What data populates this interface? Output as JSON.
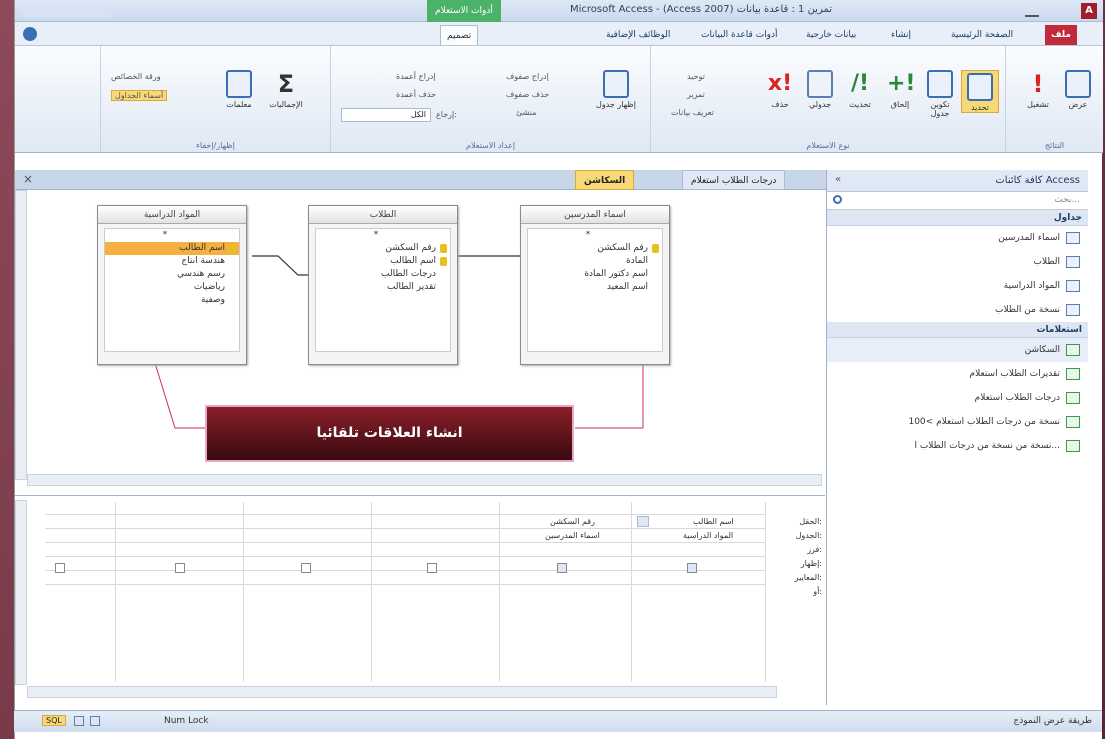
{
  "title_bar": {
    "app_title": "Microsoft Access - (Access 2007) تمرين 1 : قاعدة بيانات",
    "context_title": "أدوات الاستعلام",
    "app_badge": "A"
  },
  "tabs": [
    {
      "label": "ملف"
    },
    {
      "label": "الصفحة الرئيسية"
    },
    {
      "label": "إنشاء"
    },
    {
      "label": "بيانات خارجية"
    },
    {
      "label": "أدوات قاعدة البيانات"
    },
    {
      "label": "الوظائف الإضافية"
    },
    {
      "label": "تصميم"
    }
  ],
  "ribbon": {
    "results": {
      "label": "النتائج",
      "buttons": [
        {
          "label": "عرض"
        },
        {
          "label": "تشغيل"
        }
      ]
    },
    "query_type": {
      "label": "نوع الاستعلام",
      "buttons": [
        {
          "label": "تحديد"
        },
        {
          "label": "تكوين جدول"
        },
        {
          "label": "إلحاق"
        },
        {
          "label": "تحديث"
        },
        {
          "label": "جدولي"
        },
        {
          "label": "حذف"
        }
      ],
      "small": [
        {
          "label": "توحيد"
        },
        {
          "label": "تمرير"
        },
        {
          "label": "تعريف بيانات"
        }
      ]
    },
    "setup": {
      "label": "إعداد الاستعلام",
      "show_table": "إظهار جدول",
      "small": [
        {
          "label": "إدراج صفوف"
        },
        {
          "label": "حذف صفوف"
        },
        {
          "label": "منشئ"
        },
        {
          "label": "إدراج أعمدة"
        },
        {
          "label": "حذف أعمدة"
        },
        {
          "label": "إرجاع:"
        }
      ],
      "return_value": "الكل"
    },
    "showhide": {
      "label": "إظهار/إخفاء",
      "totals": "الإجماليات",
      "params": "معلمات",
      "property_sheet": "ورقة الخصائص",
      "table_names": "أسماء الجداول"
    }
  },
  "document_tabs": [
    {
      "label": "درجات الطلاب استعلام"
    },
    {
      "label": "السكاشن"
    }
  ],
  "tables": [
    {
      "title": "اسماء المدرسين",
      "fields": [
        "*",
        "رقم السكشن",
        "المادة",
        "اسم دكتور المادة",
        "اسم المعيد"
      ]
    },
    {
      "title": "الطلاب",
      "fields": [
        "*",
        "رقم السكشن",
        "اسم الطالب",
        "درجات الطالب",
        "تقدير الطالب"
      ]
    },
    {
      "title": "المواد الدراسية",
      "fields": [
        "*",
        "اسم الطالب",
        "هندسة انتاج",
        "رسم هندسي",
        "رياضيات",
        "وصفية"
      ]
    }
  ],
  "callout": {
    "text": "انشاء العلاقات تلقائيا"
  },
  "qbe": {
    "row_labels": [
      "الحقل:",
      "الجدول:",
      "فرز:",
      "إظهار:",
      "المعايير:",
      "أو:"
    ],
    "columns": [
      {
        "field": "اسم الطالب",
        "table": "المواد الدراسية"
      },
      {
        "field": "رقم السكشن",
        "table": "اسماء المدرسين"
      }
    ]
  },
  "nav_pane": {
    "header": "كافة كائنات Access",
    "search_placeholder": "بحث...",
    "tables_header": "جداول",
    "tables": [
      {
        "label": "اسماء المدرسين"
      },
      {
        "label": "الطلاب"
      },
      {
        "label": "المواد الدراسية"
      },
      {
        "label": "نسخة من الطلاب"
      }
    ],
    "queries_header": "استعلامات",
    "queries": [
      {
        "label": "السكاشن"
      },
      {
        "label": "تقديرات الطلاب استعلام"
      },
      {
        "label": "درجات الطلاب استعلام"
      },
      {
        "label": "نسخة من درجات الطلاب استعلام >100"
      },
      {
        "label": "نسخة من نسخة من درجات الطلاب ا..."
      }
    ]
  },
  "status_bar": {
    "left_text": "طريقة عرض النموذج",
    "num_lock": "Num Lock",
    "sql_label": "SQL"
  }
}
